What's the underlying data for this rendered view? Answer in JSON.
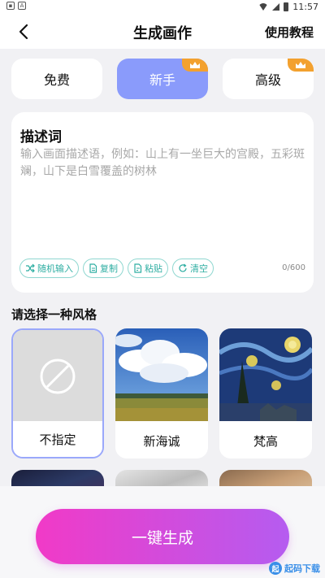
{
  "status_bar": {
    "time": "11:57"
  },
  "header": {
    "title": "生成画作",
    "tutorial_label": "使用教程"
  },
  "modes": [
    {
      "label": "免费",
      "active": false,
      "premium": false
    },
    {
      "label": "新手",
      "active": true,
      "premium": true
    },
    {
      "label": "高级",
      "active": false,
      "premium": true
    }
  ],
  "prompt": {
    "title": "描述词",
    "placeholder": "输入画面描述语，例如：山上有一坐巨大的宫殿，五彩斑斓，山下是白雪覆盖的树林",
    "value": "",
    "char_count": "0/600",
    "tools": {
      "random": "随机输入",
      "copy": "复制",
      "paste": "粘贴",
      "clear": "清空"
    }
  },
  "style_section": {
    "title": "请选择一种风格",
    "styles": [
      {
        "label": "不指定",
        "selected": true
      },
      {
        "label": "新海诚",
        "selected": false
      },
      {
        "label": "梵高",
        "selected": false
      }
    ]
  },
  "generate_label": "一键生成",
  "colors": {
    "accent": "#8a9bfb",
    "teal": "#2eaea2",
    "gradient_start": "#f13ac7",
    "gradient_end": "#b55cf0",
    "crown": "#f3a12f"
  },
  "watermark": "起码下载"
}
